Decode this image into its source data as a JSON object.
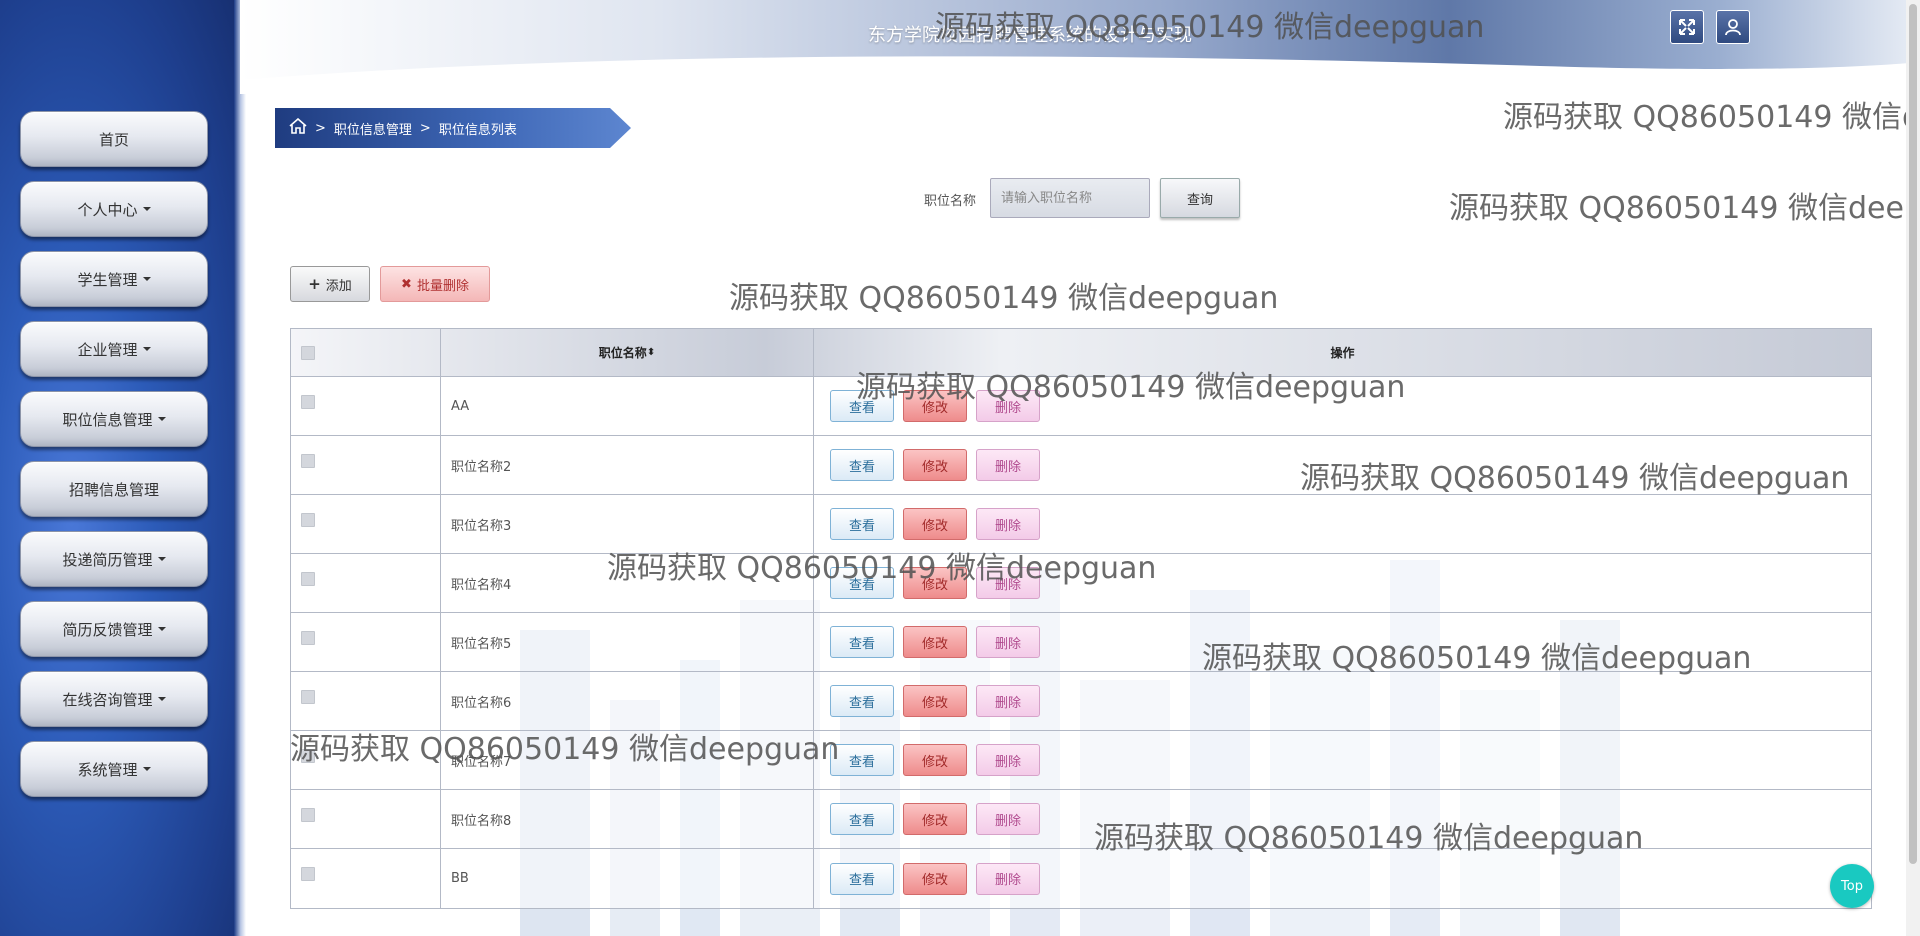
{
  "app": {
    "title": "东方学院校园招聘管理系统的设计与实现"
  },
  "sidebar": {
    "items": [
      {
        "label": "首页",
        "has_caret": false
      },
      {
        "label": "个人中心",
        "has_caret": true
      },
      {
        "label": "学生管理",
        "has_caret": true
      },
      {
        "label": "企业管理",
        "has_caret": true
      },
      {
        "label": "职位信息管理",
        "has_caret": true
      },
      {
        "label": "招聘信息管理",
        "has_caret": false
      },
      {
        "label": "投递简历管理",
        "has_caret": true
      },
      {
        "label": "简历反馈管理",
        "has_caret": true
      },
      {
        "label": "在线咨询管理",
        "has_caret": true
      },
      {
        "label": "系统管理",
        "has_caret": true
      }
    ]
  },
  "header": {
    "fullscreen_icon": "fullscreen-icon",
    "user_icon": "user-icon"
  },
  "breadcrumb": {
    "sep": ">",
    "level1": "职位信息管理",
    "level2": "职位信息列表"
  },
  "search": {
    "label": "职位名称",
    "placeholder": "请输入职位名称",
    "button": "查询"
  },
  "actions": {
    "add": "添加",
    "batch_delete": "批量删除"
  },
  "table": {
    "columns": {
      "name": "职位名称",
      "ops": "操作"
    },
    "sort_glyph": "⬍",
    "op_labels": {
      "view": "查看",
      "edit": "修改",
      "delete": "删除"
    },
    "rows": [
      "AA",
      "职位名称2",
      "职位名称3",
      "职位名称4",
      "职位名称5",
      "职位名称6",
      "职位名称7",
      "职位名称8",
      "BB"
    ]
  },
  "top_button": "Top",
  "watermark": "源码获取 QQ86050149 微信deepguan",
  "colors": {
    "sidebar": "#2c5bb8",
    "accent_teal": "#19c9c1",
    "edit": "#ee8b8b"
  }
}
